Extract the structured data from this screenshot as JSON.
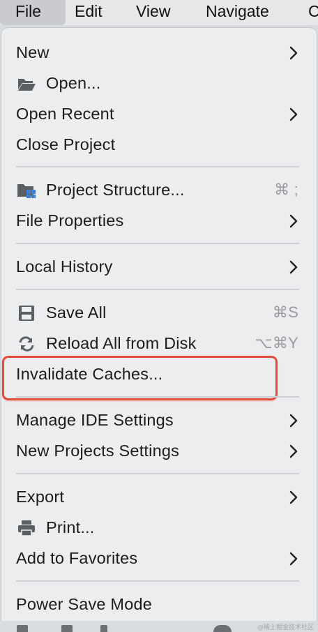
{
  "menubar": {
    "items": [
      "File",
      "Edit",
      "View",
      "Navigate",
      "C"
    ]
  },
  "menu": {
    "new": "New",
    "open": "Open...",
    "open_recent": "Open Recent",
    "close_project": "Close Project",
    "project_structure": "Project Structure...",
    "project_structure_shortcut": "⌘ ;",
    "file_properties": "File Properties",
    "local_history": "Local History",
    "save_all": "Save All",
    "save_all_shortcut": "⌘S",
    "reload_all": "Reload All from Disk",
    "reload_all_shortcut": "⌥⌘Y",
    "invalidate_caches": "Invalidate Caches...",
    "manage_ide_settings": "Manage IDE Settings",
    "new_projects_settings": "New Projects Settings",
    "export": "Export",
    "print": "Print...",
    "add_to_favorites": "Add to Favorites",
    "power_save_mode": "Power Save Mode"
  },
  "watermark": "@稀土掘金技术社区",
  "colors": {
    "menu_bg": "#ecedef",
    "highlight": "#e24d3b",
    "shortcut": "#9a9a9e"
  }
}
